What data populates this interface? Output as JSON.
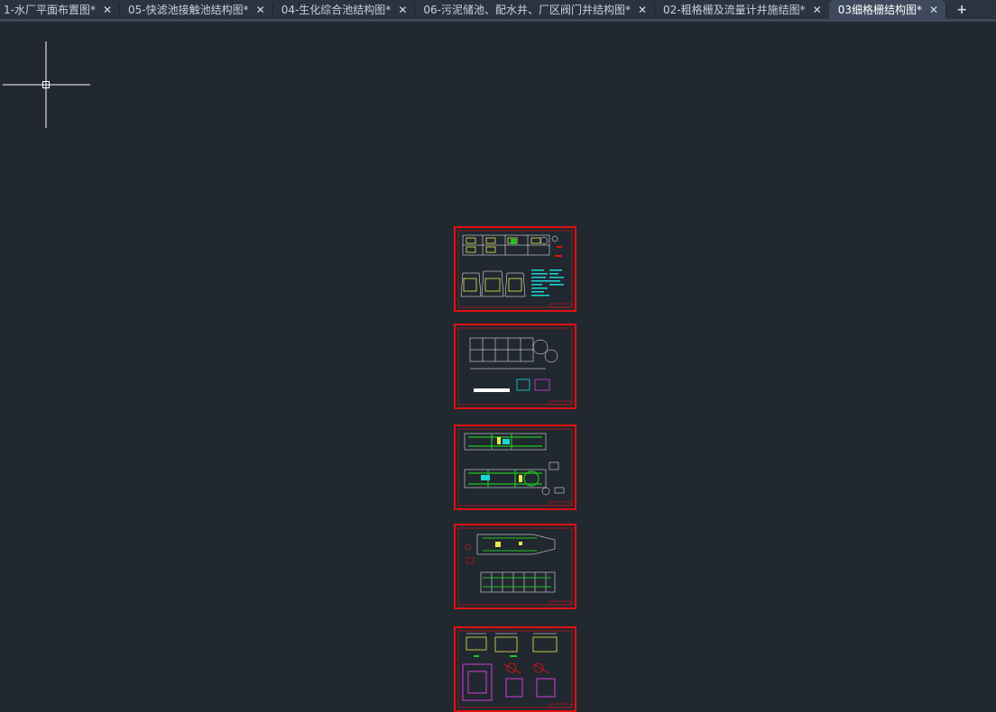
{
  "tabs": [
    {
      "label": "1-水厂平面布置图*",
      "active": false
    },
    {
      "label": "05-快滤池接触池结构图*",
      "active": false
    },
    {
      "label": "04-生化综合池结构图*",
      "active": false
    },
    {
      "label": "06-污泥储池、配水井、厂区阀门井结构图*",
      "active": false
    },
    {
      "label": "02-粗格栅及流量计井施结图*",
      "active": false
    },
    {
      "label": "03细格栅结构图*",
      "active": true
    }
  ],
  "close_glyph": "✕",
  "add_glyph": "+",
  "colors": {
    "canvas_bg": "#212830",
    "sheet_border": "#e01010",
    "crosshair": "#ffffff"
  },
  "sheets": [
    {
      "name": "sheet-1",
      "content": "plan-sections-cyan-notes"
    },
    {
      "name": "sheet-2",
      "content": "plan-white-outline"
    },
    {
      "name": "sheet-3",
      "content": "plan-green-reinforcement"
    },
    {
      "name": "sheet-4",
      "content": "plan-white-green-elevation"
    },
    {
      "name": "sheet-5",
      "content": "details-magenta"
    }
  ]
}
